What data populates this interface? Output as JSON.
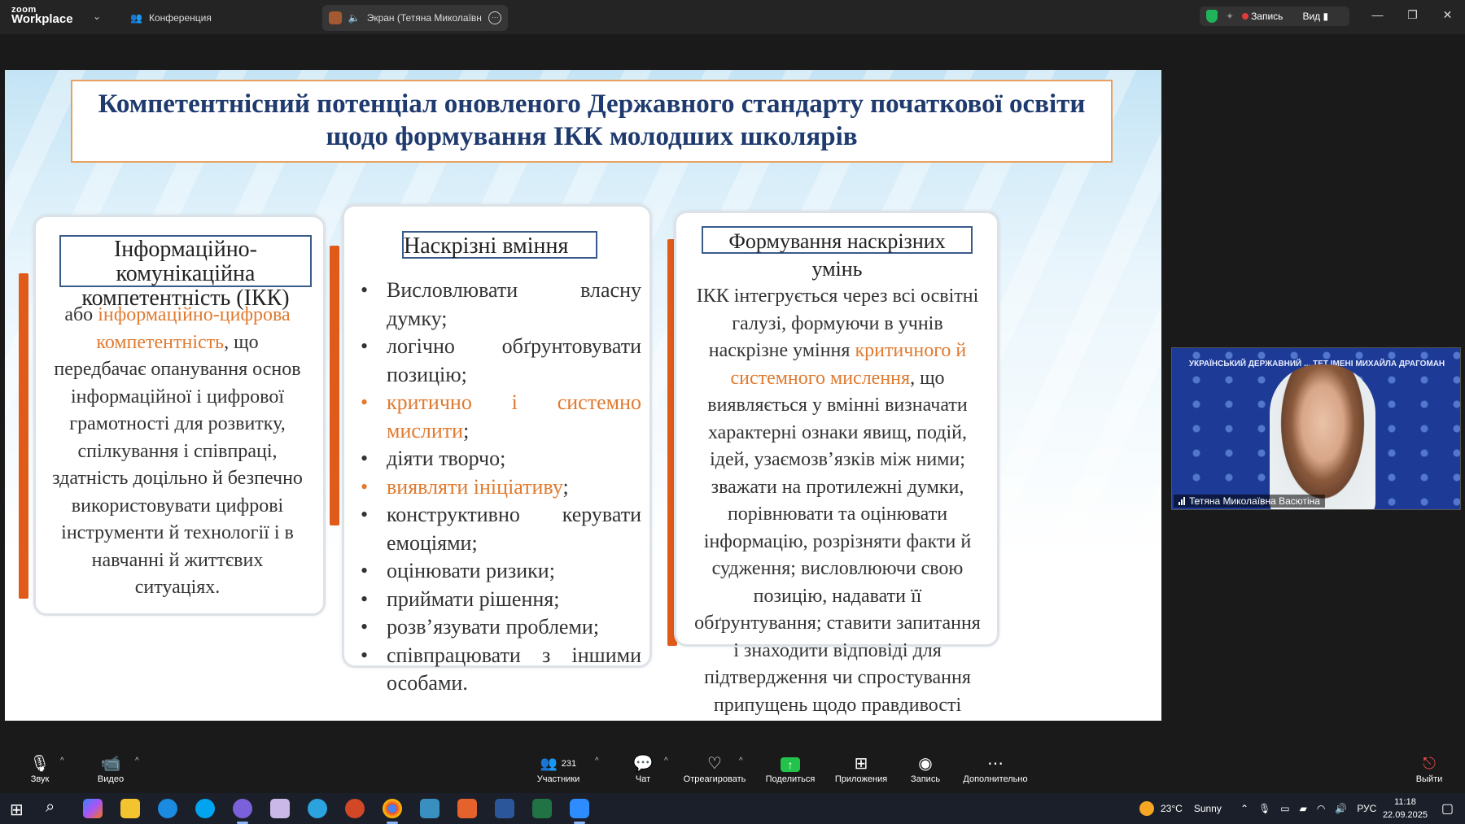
{
  "app": {
    "brand_line1": "zoom",
    "brand_line2": "Workplace",
    "conference_tab": "Конференция",
    "share_tab": "Экран (Тетяна Миколаївна В",
    "record_label": "Запись",
    "view_label": "Вид"
  },
  "slide": {
    "title": "Компетентнісний потенціал оновленого Державного стандарту початкової освіти щодо формування ІКК молодших школярів",
    "left": {
      "heading": "Інформаційно-комунікаційна компетентність (ІКК)",
      "text_pre": "або ",
      "text_hl": "інформаційно-цифрова компетентність",
      "text_post": ", що передбачає опанування основ інформаційної і цифрової грамотності для розвитку, спілкування і співпраці, здатність доцільно й безпечно використовувати цифрові інструменти й технології і в навчанні й життєвих ситуаціях."
    },
    "middle": {
      "heading": "Наскрізні вміння",
      "bullets": [
        "Висловлювати власну думку;",
        "логічно обґрунтовувати позицію;",
        "критично і системно мислити",
        "діяти творчо;",
        "виявляти ініціативу",
        "конструктивно керувати емоціями;",
        "оцінювати ризики;",
        "приймати рішення;",
        "розв’язувати проблеми;",
        "співпрацювати з іншими особами."
      ],
      "semicolon": ";"
    },
    "right": {
      "heading": "Формування наскрізних умінь",
      "text_pre": "ІКК інтегрується через всі освітні галузі, формуючи в учнів наскрізне уміння ",
      "text_hl": "критичного й системного мислення",
      "text_post": ", що виявляється у вмінні визначати характерні ознаки явищ, подій, ідей, узаємозв’язків між ними; зважати на протилежні думки, порівнювати та оцінювати інформацію, розрізняти факти й судження; висловлюючи свою позицію, надавати її обґрунтування; ставити запитання і знаходити відповіді для підтвердження чи спростування припущень щодо правдивості інформації."
    }
  },
  "video": {
    "banner": "УКРАЇНСЬКИЙ ДЕРЖАВНИЙ ... ТЕТ ІМЕНІ МИХАЙЛА ДРАГОМАН",
    "participant_name": "Тетяна Миколаївна Васютіна"
  },
  "toolbar": {
    "audio": "Звук",
    "video": "Видео",
    "participants": "Участники",
    "participants_count": "231",
    "chat": "Чат",
    "react": "Отреагировать",
    "share": "Поделиться",
    "apps": "Приложения",
    "record": "Запись",
    "more": "Дополнительно",
    "leave": "Выйти"
  },
  "taskbar": {
    "weather_temp": "23°C",
    "weather_desc": "Sunny",
    "lang": "РУС",
    "time": "11:18",
    "date": "22.09.2025"
  },
  "colors": {
    "accent_orange": "#e05a1a",
    "highlight_text": "#e07a2f",
    "title_blue": "#1e3a6e",
    "share_green": "#23c24b",
    "record_red": "#e03b3b"
  }
}
